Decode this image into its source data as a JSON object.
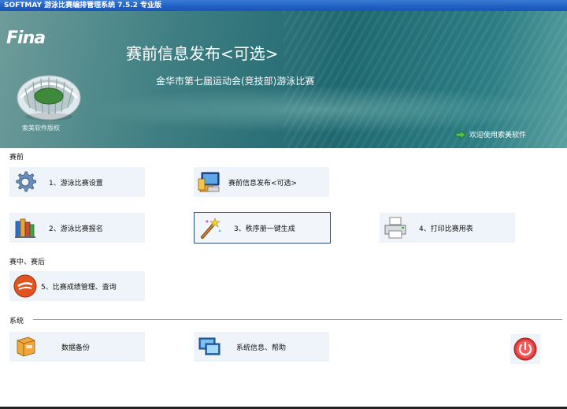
{
  "window": {
    "title": "SOFTMAY 游泳比赛编排管理系统 7.5.2  专业版"
  },
  "banner": {
    "logo_text": "Fina",
    "copyright": "索美软件版权",
    "page_title": "赛前信息发布<可选>",
    "event_name": "金华市第七届运动会(竞技部)游泳比赛",
    "welcome": "欢迎使用索美软件"
  },
  "sections": {
    "pre": "赛前",
    "during": "赛中、赛后",
    "system": "系统"
  },
  "tiles": {
    "setup": {
      "label": "1、游泳比赛设置",
      "icon": "gear-icon"
    },
    "publish": {
      "label": "赛前信息发布<可选>",
      "icon": "computer-info-icon"
    },
    "register": {
      "label": "2、游泳比赛报名",
      "icon": "books-icon"
    },
    "order": {
      "label": "3、秩序册一键生成",
      "icon": "magic-wand-icon"
    },
    "print": {
      "label": "4、打印比赛用表",
      "icon": "printer-icon"
    },
    "results": {
      "label": "5、比赛成绩管理、查询",
      "icon": "results-icon"
    },
    "backup": {
      "label": "数据备份",
      "icon": "database-icon"
    },
    "sysinfo": {
      "label": "系统信息、帮助",
      "icon": "monitor-icon"
    }
  },
  "colors": {
    "banner_dark": "#1f6870",
    "tile_bg": "#eef4fa",
    "selected_border": "#2a4d7c",
    "titlebar": "#1f5fc4"
  }
}
